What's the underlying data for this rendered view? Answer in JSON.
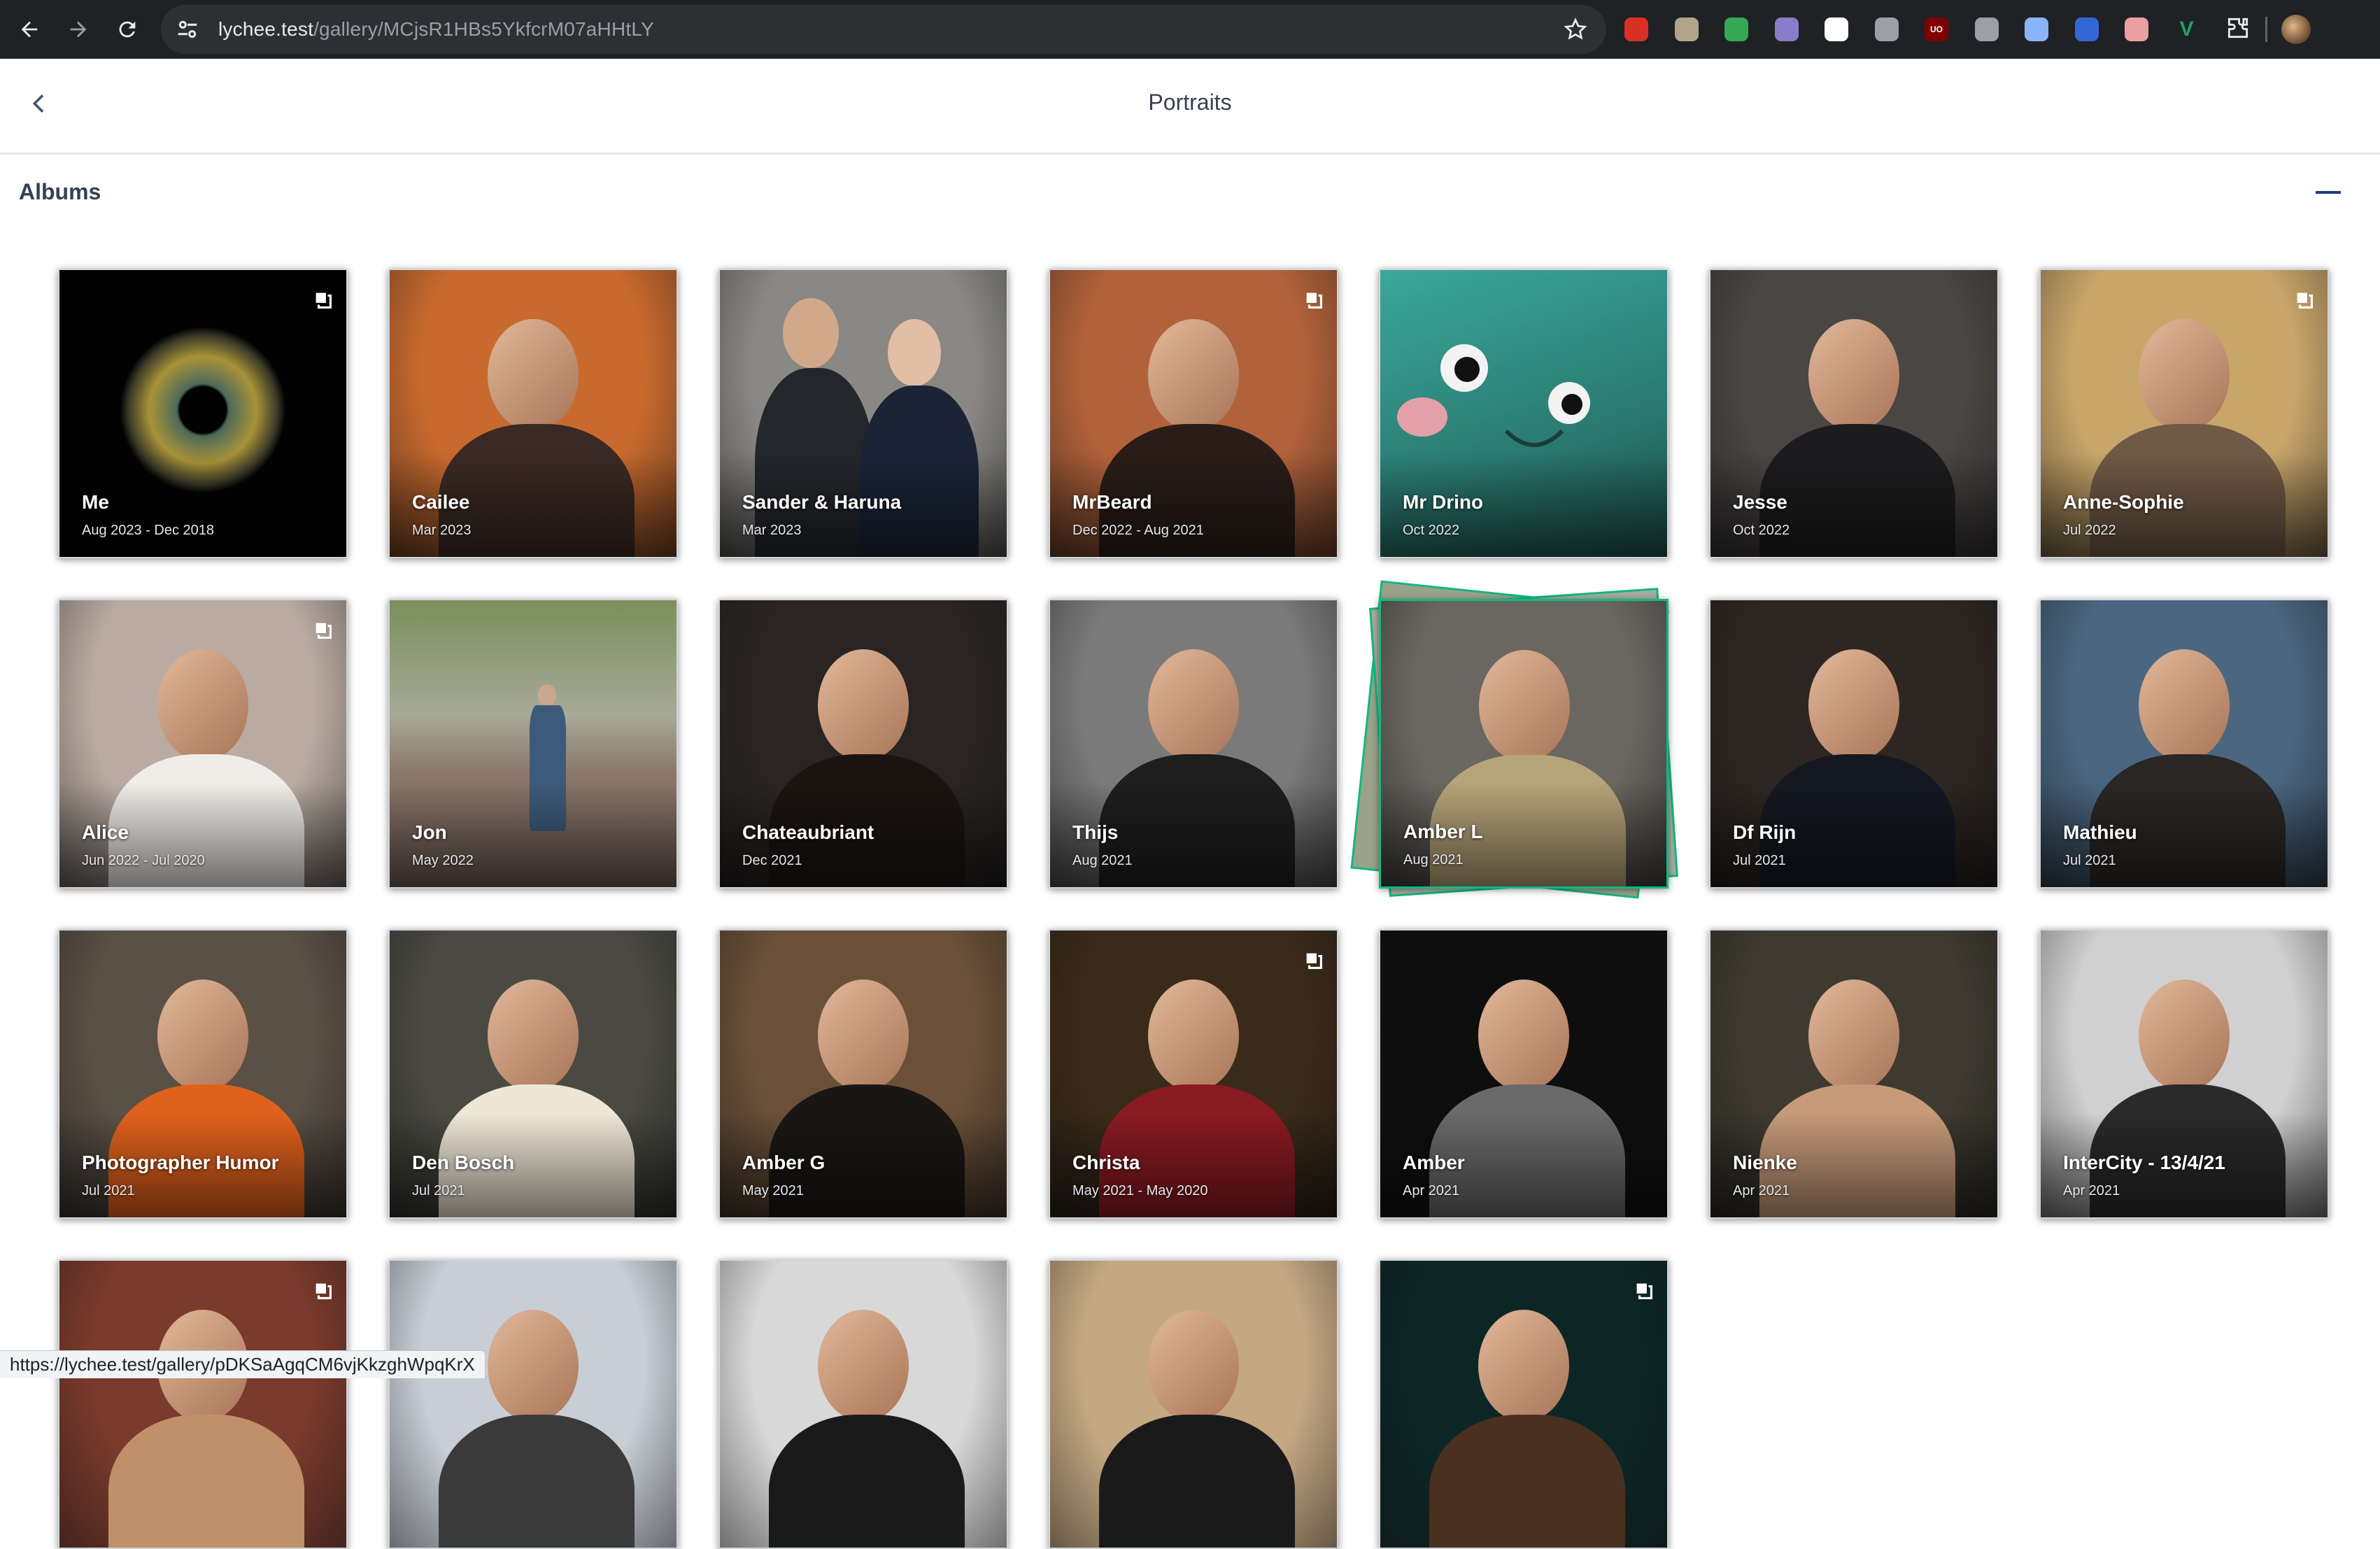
{
  "browser": {
    "url_host": "lychee.test",
    "url_path": "/gallery/MCjsR1HBs5YkfcrM07aHHtLY",
    "extensions": [
      {
        "icon": "shield-red-icon",
        "color": "#d93025",
        "label": ""
      },
      {
        "icon": "eyes-icon",
        "color": "#b0a48a",
        "label": ""
      },
      {
        "icon": "puzzle-green-icon",
        "color": "#34a853",
        "label": ""
      },
      {
        "icon": "fox-icon",
        "color": "#8b7cc9",
        "label": ""
      },
      {
        "icon": "circle-red-icon",
        "color": "#ffffff",
        "label": ""
      },
      {
        "icon": "drop-icon",
        "color": "#9aa0a6",
        "label": ""
      },
      {
        "icon": "ublock-icon",
        "color": "#800000",
        "label": "UO"
      },
      {
        "icon": "shield-gray-icon",
        "color": "#9aa0a6",
        "label": ""
      },
      {
        "icon": "screenshot-icon",
        "color": "#8ab4f8",
        "label": ""
      },
      {
        "icon": "globe-icon",
        "color": "#3367d6",
        "label": ""
      },
      {
        "icon": "pie-icon",
        "color": "#e8a0a0",
        "label": ""
      },
      {
        "icon": "v-icon",
        "color": "#1da462",
        "label": "V"
      }
    ]
  },
  "header": {
    "title": "Portraits"
  },
  "section": {
    "title": "Albums"
  },
  "albums": [
    {
      "name": "Me",
      "date": "Aug 2023 - Dec 2018",
      "has_sub": true,
      "bg": "#020202",
      "accent": "#8a7a2e",
      "kind": "eye"
    },
    {
      "name": "Cailee",
      "date": "Mar 2023",
      "has_sub": false,
      "bg": "#c86a2e",
      "accent": "#3b2a24",
      "kind": "person"
    },
    {
      "name": "Sander & Haruna",
      "date": "Mar 2023",
      "has_sub": false,
      "bg": "#8a8884",
      "accent": "#23262b",
      "kind": "couple"
    },
    {
      "name": "MrBeard",
      "date": "Dec 2022 - Aug 2021",
      "has_sub": true,
      "bg": "#b2623a",
      "accent": "#2a1d18",
      "kind": "person"
    },
    {
      "name": "Mr Drino",
      "date": "Oct 2022",
      "has_sub": false,
      "bg": "#2a7a70",
      "accent": "#3aa89a",
      "kind": "plush"
    },
    {
      "name": "Jesse",
      "date": "Oct 2022",
      "has_sub": false,
      "bg": "#4a4644",
      "accent": "#1c1c1e",
      "kind": "person"
    },
    {
      "name": "Anne-Sophie",
      "date": "Jul 2022",
      "has_sub": true,
      "bg": "#c8a66a",
      "accent": "#6f5a46",
      "kind": "person"
    },
    {
      "name": "Alice",
      "date": "Jun 2022 - Jul 2020",
      "has_sub": true,
      "bg": "#b9aba2",
      "accent": "#f0ece8",
      "kind": "person"
    },
    {
      "name": "Jon",
      "date": "May 2022",
      "has_sub": false,
      "bg": "#8c8a7e",
      "accent": "#3d5a7a",
      "kind": "street"
    },
    {
      "name": "Chateaubriant",
      "date": "Dec 2021",
      "has_sub": false,
      "bg": "#2a2522",
      "accent": "#1a1410",
      "kind": "person"
    },
    {
      "name": "Thijs",
      "date": "Aug 2021",
      "has_sub": false,
      "bg": "#7a7a7a",
      "accent": "#1e1e1e",
      "kind": "person"
    },
    {
      "name": "Amber L",
      "date": "Aug 2021",
      "has_sub": false,
      "bg": "#6a6660",
      "accent": "#b7a57a",
      "kind": "person"
    },
    {
      "name": "Df Rijn",
      "date": "Jul 2021",
      "has_sub": false,
      "bg": "#2e2622",
      "accent": "#141821",
      "kind": "person"
    },
    {
      "name": "Mathieu",
      "date": "Jul 2021",
      "has_sub": false,
      "bg": "#4a6680",
      "accent": "#2a2624",
      "kind": "person"
    },
    {
      "name": "Photographer Humor",
      "date": "Jul 2021",
      "has_sub": false,
      "bg": "#5a5046",
      "accent": "#e0611c",
      "kind": "person"
    },
    {
      "name": "Den Bosch",
      "date": "Jul 2021",
      "has_sub": false,
      "bg": "#4a4a42",
      "accent": "#efe6d6",
      "kind": "person"
    },
    {
      "name": "Amber G",
      "date": "May 2021",
      "has_sub": false,
      "bg": "#6a5038",
      "accent": "#1a1614",
      "kind": "person"
    },
    {
      "name": "Christa",
      "date": "May 2021 - May 2020",
      "has_sub": true,
      "bg": "#3a2a1a",
      "accent": "#8a1a22",
      "kind": "person"
    },
    {
      "name": "Amber",
      "date": "Apr 2021",
      "has_sub": false,
      "bg": "#0e0e0e",
      "accent": "#6a6a6a",
      "kind": "person"
    },
    {
      "name": "Nienke",
      "date": "Apr 2021",
      "has_sub": false,
      "bg": "#3e3a30",
      "accent": "#c79a7a",
      "kind": "person"
    },
    {
      "name": "InterCity - 13/4/21",
      "date": "Apr 2021",
      "has_sub": false,
      "bg": "#d0d0d0",
      "accent": "#2a2a2a",
      "kind": "person"
    },
    {
      "name": "",
      "date": "",
      "has_sub": true,
      "bg": "#7a3a2c",
      "accent": "#c0906a",
      "kind": "person"
    },
    {
      "name": "",
      "date": "",
      "has_sub": false,
      "bg": "#c8ced6",
      "accent": "#3a3a3a",
      "kind": "person"
    },
    {
      "name": "",
      "date": "",
      "has_sub": false,
      "bg": "#d8d8d8",
      "accent": "#1a1a1a",
      "kind": "person"
    },
    {
      "name": "",
      "date": "",
      "has_sub": false,
      "bg": "#c4a882",
      "accent": "#1a1a1a",
      "kind": "person"
    },
    {
      "name": "",
      "date": "",
      "has_sub": true,
      "bg": "#0c2626",
      "accent": "#4a3020",
      "kind": "person"
    }
  ],
  "statusbar": {
    "text": "https://lychee.test/gallery/pDKSaAgqCM6vjKkzghWpqKrX"
  }
}
